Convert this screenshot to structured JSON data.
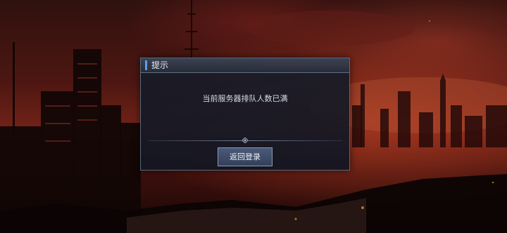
{
  "dialog": {
    "title": "提示",
    "message": "当前服务器排队人数已满",
    "button_label": "返回登录"
  },
  "colors": {
    "accent": "#5aa0e8",
    "sky_red": "#8a2a1c",
    "panel": "#181c28"
  }
}
